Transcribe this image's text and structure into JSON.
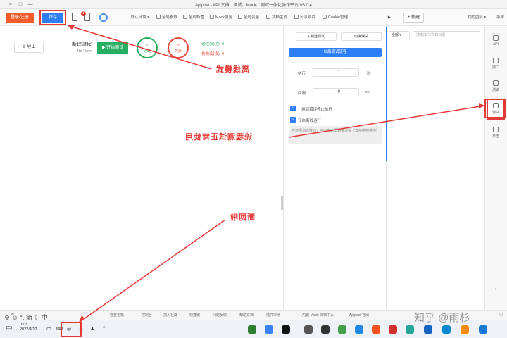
{
  "window": {
    "title": "Apipost - API 文档、调试、Mock、测试一体化协作平台 V6.0.4",
    "controls": [
      "×",
      "□",
      "—"
    ]
  },
  "toolbar": {
    "user_label": "登录/注册",
    "save_label": "保存",
    "notification_count": "1",
    "new_tab_label": "+ 新建",
    "items": [
      "默认环境",
      "全局参数",
      "全局断言",
      "Cookie管理",
      "分享项目",
      "文档生成",
      "全局变量",
      "Mock服务"
    ],
    "menu_label": "菜单",
    "team_label": "我的团队"
  },
  "sidenav": {
    "items": [
      {
        "label": "API",
        "icon": "api-icon"
      },
      {
        "label": "接口",
        "icon": "link-icon"
      },
      {
        "label": "测试",
        "icon": "flask-icon"
      },
      {
        "label": "测试",
        "icon": "test-icon"
      },
      {
        "label": "日志",
        "icon": "log-icon"
      }
    ]
  },
  "collection": {
    "search_placeholder": "搜索接口/文档目录",
    "filter_value": "全部"
  },
  "settings": {
    "btn_switch": "切换测试",
    "btn_new": "+ 新建测试",
    "run_label": "以后调试流程",
    "run_times_label": "执行",
    "run_times_unit": "次",
    "run_times_value": "1",
    "interval_label": "间隔",
    "interval_unit": "ms",
    "interval_value": "0",
    "check1_label": "遇到错误停止执行",
    "check2_label": "开启离线运行",
    "hint": "在左侧勾选接口，可以在这里调试流程（支持拖拽排序）"
  },
  "main": {
    "process_title": "新建流程",
    "process_sub": "No Time",
    "start_label": "▶ 开始测试",
    "pass_count": "0",
    "pass_label": "通过",
    "fail_count": "0",
    "fail_label": "失败",
    "stat_pass": "通过(成功): 0",
    "stat_fail": "失败(错误): 0",
    "export_label": "导出"
  },
  "statusbar": {
    "items": [
      "Apipost 官网",
      "内置 Mock 文档中心",
      "插件市场",
      "帮助文档",
      "问题反馈",
      "快捷键",
      "加入社群",
      "控制台",
      "检查更新"
    ]
  },
  "taskbar": {
    "time": "0:03",
    "date": "2022/4/12",
    "ime": "中",
    "ime2": "简"
  },
  "annotations": {
    "offline": "离线模式",
    "normal": "流程测试正常使用",
    "disconnect": "断网啦"
  },
  "watermark": "知乎 @雨杉"
}
